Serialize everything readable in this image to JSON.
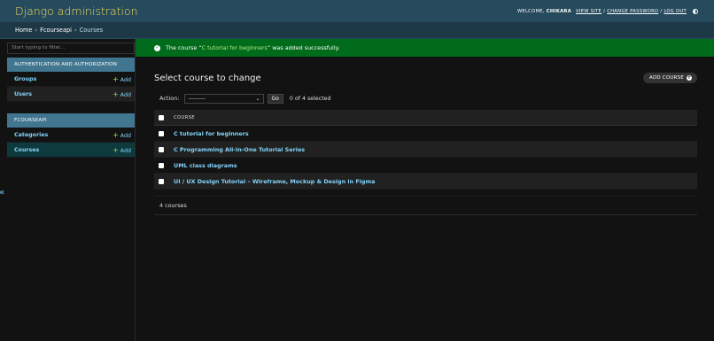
{
  "header": {
    "site_name": "Django administration",
    "welcome": "WELCOME,",
    "username": "CHIKARA",
    "view_site": "VIEW SITE",
    "change_password": "CHANGE PASSWORD",
    "log_out": "LOG OUT",
    "separator": "/"
  },
  "breadcrumbs": {
    "home": "Home",
    "app": "Fcourseapi",
    "current": "Courses",
    "sep": "›"
  },
  "sidebar": {
    "filter_placeholder": "Start typing to filter...",
    "toggle": "«",
    "add_label": "Add",
    "groups": [
      {
        "caption": "AUTHENTICATION AND AUTHORIZATION",
        "models": [
          {
            "name": "Groups"
          },
          {
            "name": "Users"
          }
        ]
      },
      {
        "caption": "FCOURSEAPI",
        "models": [
          {
            "name": "Categories"
          },
          {
            "name": "Courses"
          }
        ]
      }
    ]
  },
  "message": {
    "before": "The course “",
    "link": "C tutorial for beginners",
    "after": "” was added successfully."
  },
  "main": {
    "title": "Select course to change",
    "add_button": "ADD COURSE",
    "action_label": "Action:",
    "action_selected": "---------",
    "go": "Go",
    "selected_count": "0 of 4 selected",
    "column_header": "COURSE",
    "rows": [
      "C tutorial for beginners",
      "C Programming All-in-One Tutorial Series",
      "UML class diagrams",
      "UI / UX Design Tutorial – Wireframe, Mockup & Design in Figma"
    ],
    "paginator": "4 courses"
  },
  "colors": {
    "header_bg": "#264b5d",
    "brand_yellow": "#f5dd5d",
    "module_caption_bg": "#417690",
    "success_bg": "#006b1b",
    "link": "#81d4fa",
    "add_plus": "#70bf2b"
  }
}
